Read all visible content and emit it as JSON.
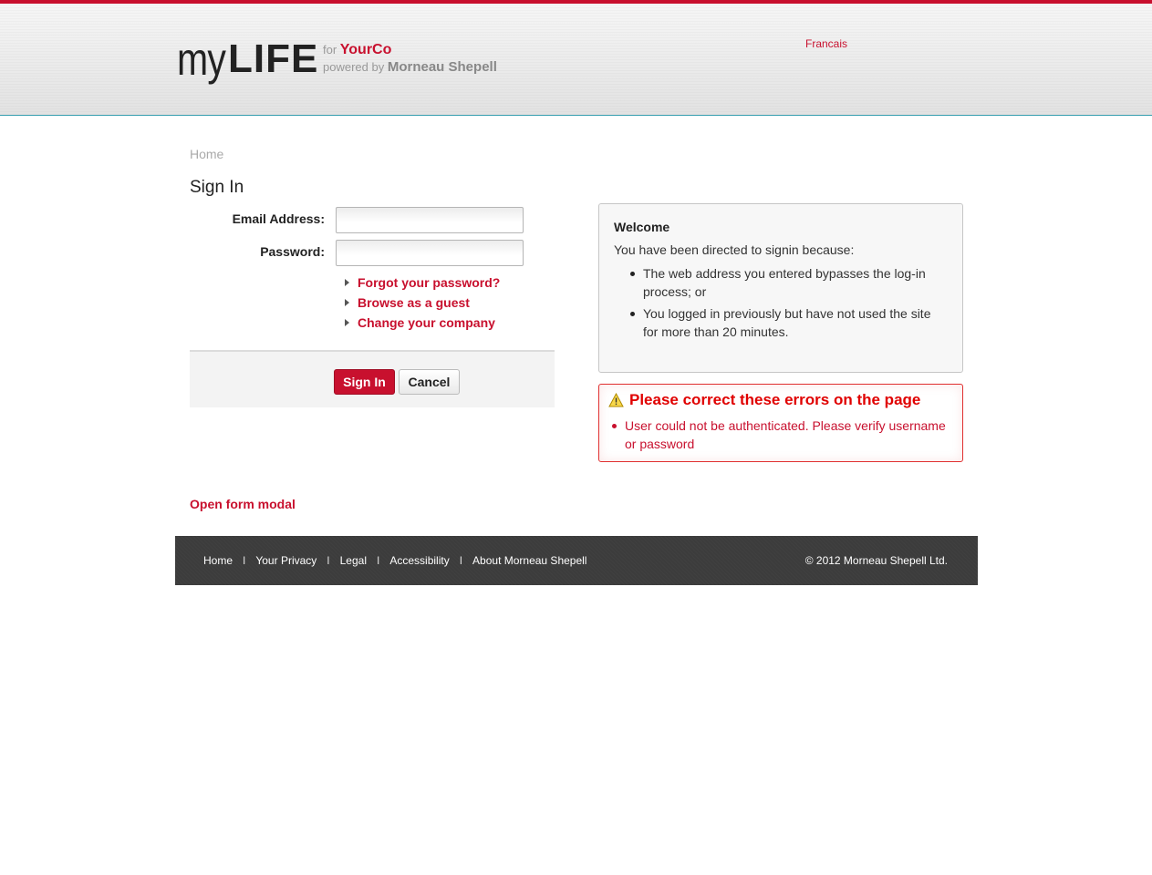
{
  "header": {
    "logo_my": "my",
    "logo_life": "LIFE",
    "for_label": "for",
    "company": "YourCo",
    "powered_label": "powered by",
    "powered_company": "Morneau Shepell",
    "language_link": "Francais"
  },
  "breadcrumb": "Home",
  "signin": {
    "title": "Sign In",
    "email_label": "Email Address:",
    "email_value": "",
    "password_label": "Password:",
    "password_value": "",
    "links": [
      "Forgot your password?",
      "Browse as a guest",
      "Change your company"
    ],
    "submit_label": "Sign In",
    "cancel_label": "Cancel"
  },
  "welcome": {
    "title": "Welcome",
    "intro": "You have been directed to signin because:",
    "reasons": [
      "The web address you entered bypasses the log-in process; or",
      "You logged in previously but have not used the site for more than 20 minutes."
    ]
  },
  "errors": {
    "title": "Please correct these errors on the page",
    "items": [
      "User could not be authenticated. Please verify username or password"
    ],
    "icon": "warning-icon"
  },
  "modal_link": "Open form modal",
  "footer": {
    "links": [
      "Home",
      "Your Privacy",
      "Legal",
      "Accessibility",
      "About Morneau Shepell"
    ],
    "separator": "I",
    "copyright": "© 2012 Morneau Shepell Ltd."
  },
  "colors": {
    "accent": "#c8102e",
    "error": "#e00000",
    "footer_bg": "#3c3c3c"
  }
}
